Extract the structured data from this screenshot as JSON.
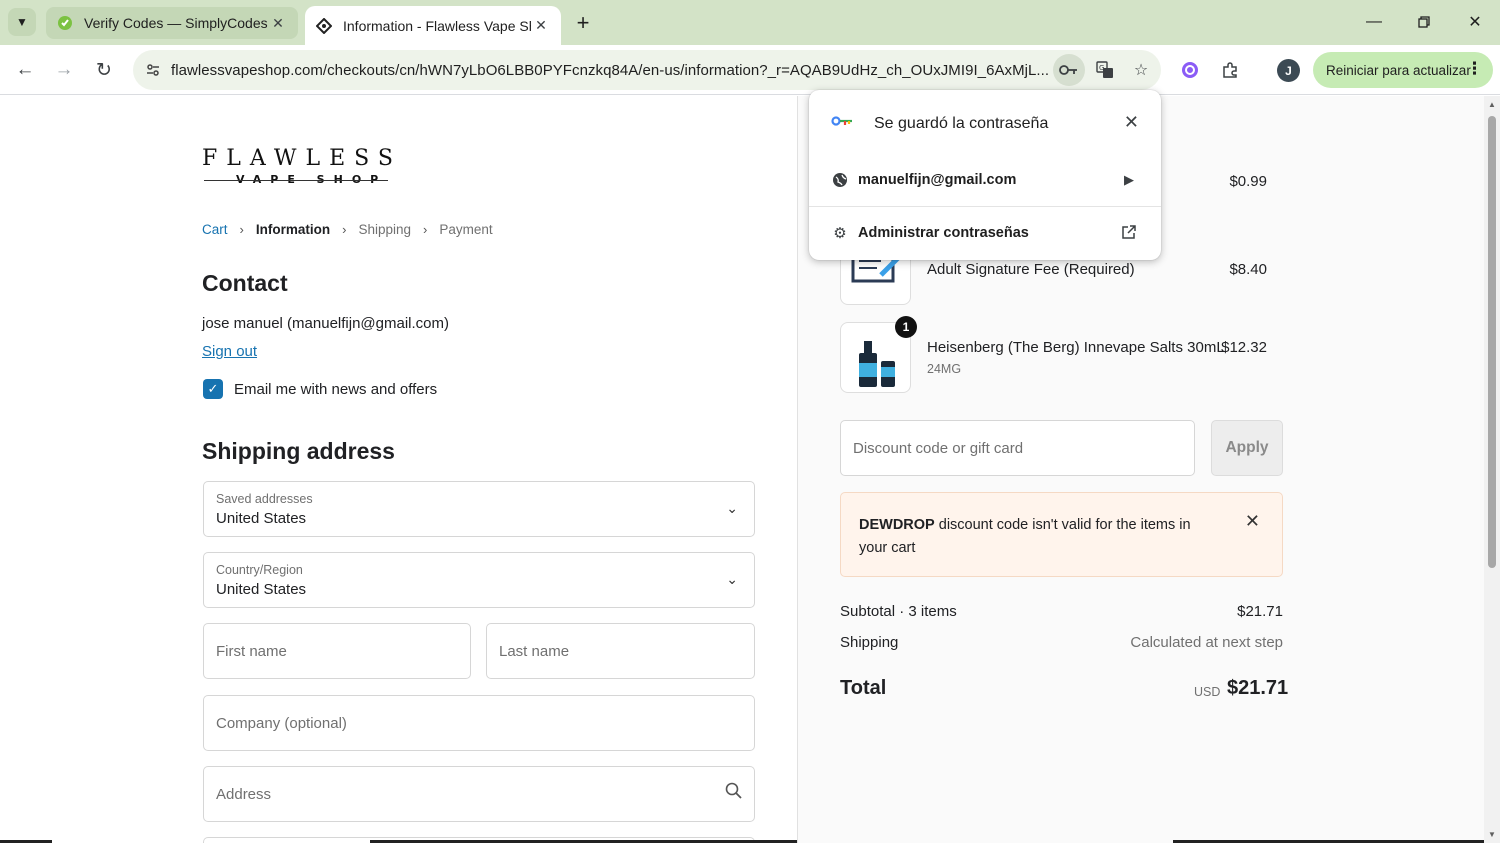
{
  "browser": {
    "tabs": [
      {
        "title": "Verify Codes — SimplyCodes",
        "favicon": "tag-icon"
      },
      {
        "title": "Information - Flawless Vape Sho",
        "favicon": "diamond-icon"
      }
    ],
    "url": "flawlessvapeshop.com/checkouts/cn/hWN7yLbO6LBB0PYFcnzkq84A/en-us/information?_r=AQAB9UdHz_ch_OUxJMI9I_6AxMjL...",
    "profile_initial": "J",
    "update_button": "Reiniciar para actualizar"
  },
  "password_popup": {
    "title": "Se guardó la contraseña",
    "account": "manuelfijn@gmail.com",
    "manage": "Administrar contraseñas"
  },
  "store": {
    "logo_word": "FLAWLESS",
    "logo_sub": "VAPE SHOP"
  },
  "breadcrumb": {
    "cart": "Cart",
    "information": "Information",
    "shipping": "Shipping",
    "payment": "Payment"
  },
  "contact": {
    "heading": "Contact",
    "user": "jose manuel (manuelfijn@gmail.com)",
    "sign_out": "Sign out",
    "newsletter_label": "Email me with news and offers",
    "newsletter_checked": true
  },
  "shipping": {
    "heading": "Shipping address",
    "saved_label": "Saved addresses",
    "saved_value": "United States",
    "country_label": "Country/Region",
    "country_value": "United States",
    "first_name_ph": "First name",
    "last_name_ph": "Last name",
    "company_ph": "Company (optional)",
    "address_ph": "Address"
  },
  "order": {
    "items": [
      {
        "name": "",
        "price": "$0.99"
      },
      {
        "name": "Adult Signature Fee (Required)",
        "price": "$8.40"
      },
      {
        "name": "Heisenberg (The Berg) Innevape Salts 30mL",
        "variant": "24MG",
        "price": "$12.32",
        "qty": "1"
      }
    ],
    "discount_ph": "Discount code or gift card",
    "apply_label": "Apply",
    "alert_code": "DEWDROP",
    "alert_text": " discount code isn't valid for the items in your cart",
    "subtotal_label": "Subtotal · 3 items",
    "subtotal_value": "$21.71",
    "shipping_label": "Shipping",
    "shipping_value": "Calculated at next step",
    "total_label": "Total",
    "total_currency": "USD",
    "total_value": "$21.71"
  },
  "colors": {
    "accent": "#1773b0",
    "alert_bg": "#fff4ec",
    "chrome_tabstrip": "#d3e3c7",
    "update_btn": "#c6ebb4"
  }
}
